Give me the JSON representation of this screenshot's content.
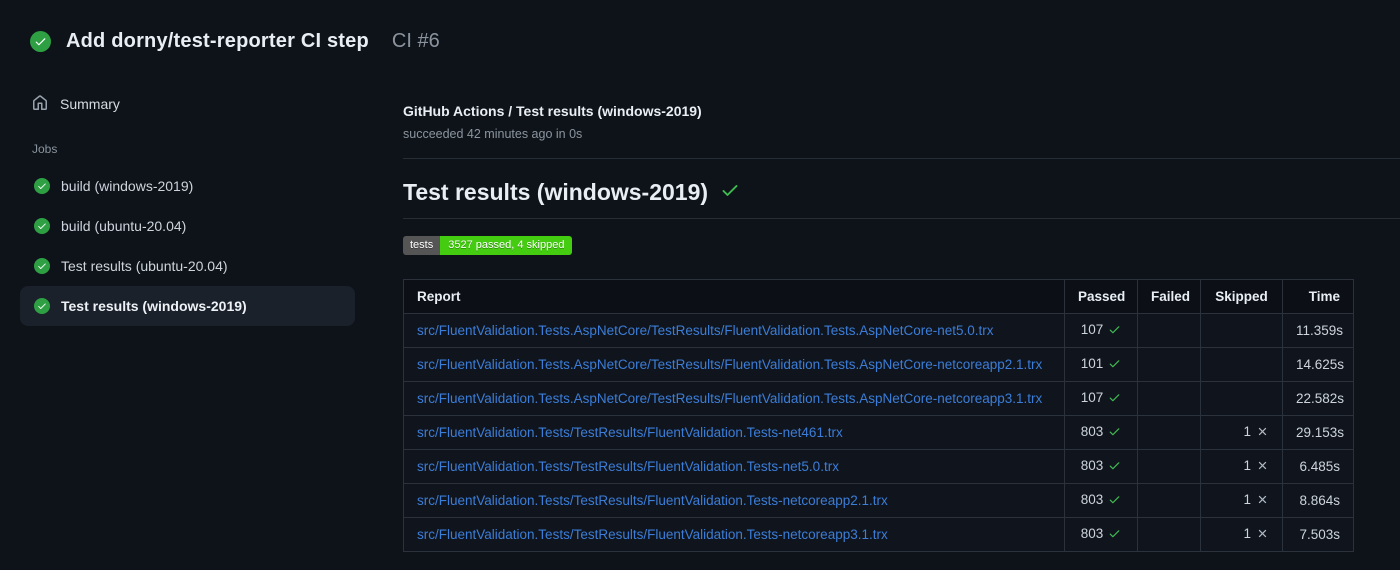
{
  "header": {
    "title": "Add dorny/test-reporter CI step",
    "run_number": "CI #6"
  },
  "sidebar": {
    "summary_label": "Summary",
    "jobs_label": "Jobs",
    "jobs": [
      {
        "label": "build (windows-2019)",
        "status": "success",
        "selected": false
      },
      {
        "label": "build (ubuntu-20.04)",
        "status": "success",
        "selected": false
      },
      {
        "label": "Test results (ubuntu-20.04)",
        "status": "success",
        "selected": false
      },
      {
        "label": "Test results (windows-2019)",
        "status": "success",
        "selected": true
      }
    ]
  },
  "main": {
    "check_title": "GitHub Actions / Test results (windows-2019)",
    "check_status": "succeeded 42 minutes ago in 0s",
    "section_heading": "Test results (windows-2019)",
    "badge": {
      "label": "tests",
      "value": "3527 passed, 4 skipped",
      "label_bg": "#555555",
      "value_bg": "#44cc11"
    },
    "table": {
      "columns": [
        "Report",
        "Passed",
        "Failed",
        "Skipped",
        "Time"
      ],
      "rows": [
        {
          "report": "src/FluentValidation.Tests.AspNetCore/TestResults/FluentValidation.Tests.AspNetCore-net5.0.trx",
          "passed": "107",
          "failed": "",
          "skipped": "",
          "time": "11.359s"
        },
        {
          "report": "src/FluentValidation.Tests.AspNetCore/TestResults/FluentValidation.Tests.AspNetCore-netcoreapp2.1.trx",
          "passed": "101",
          "failed": "",
          "skipped": "",
          "time": "14.625s"
        },
        {
          "report": "src/FluentValidation.Tests.AspNetCore/TestResults/FluentValidation.Tests.AspNetCore-netcoreapp3.1.trx",
          "passed": "107",
          "failed": "",
          "skipped": "",
          "time": "22.582s"
        },
        {
          "report": "src/FluentValidation.Tests/TestResults/FluentValidation.Tests-net461.trx",
          "passed": "803",
          "failed": "",
          "skipped": "1",
          "time": "29.153s"
        },
        {
          "report": "src/FluentValidation.Tests/TestResults/FluentValidation.Tests-net5.0.trx",
          "passed": "803",
          "failed": "",
          "skipped": "1",
          "time": "6.485s"
        },
        {
          "report": "src/FluentValidation.Tests/TestResults/FluentValidation.Tests-netcoreapp2.1.trx",
          "passed": "803",
          "failed": "",
          "skipped": "1",
          "time": "8.864s"
        },
        {
          "report": "src/FluentValidation.Tests/TestResults/FluentValidation.Tests-netcoreapp3.1.trx",
          "passed": "803",
          "failed": "",
          "skipped": "1",
          "time": "7.503s"
        }
      ]
    }
  },
  "colors": {
    "background": "#0e1319",
    "success_green": "#2ea043",
    "check_green": "#3fb950",
    "link_blue": "#3b7dd8",
    "skip_gray": "#b1bac4"
  }
}
